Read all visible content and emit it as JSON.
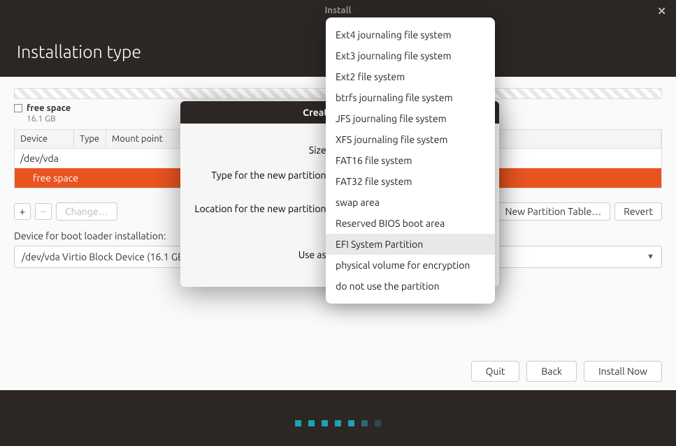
{
  "titlebar": {
    "title": "Install"
  },
  "page": {
    "title": "Installation type"
  },
  "disk": {
    "legend_name": "free space",
    "legend_size": "16.1 GB"
  },
  "table": {
    "headers": {
      "device": "Device",
      "type": "Type",
      "mount": "Mount point"
    },
    "rows": [
      {
        "device": "/dev/vda",
        "selected": false
      },
      {
        "device": "free space",
        "selected": true
      }
    ]
  },
  "toolbar": {
    "add": "+",
    "remove": "−",
    "change": "Change…",
    "new_table": "New Partition Table…",
    "revert": "Revert"
  },
  "bootloader": {
    "label": "Device for boot loader installation:",
    "value": "/dev/vda Virtio Block Device (16.1 GB)"
  },
  "footer": {
    "quit": "Quit",
    "back": "Back",
    "install": "Install Now"
  },
  "modal": {
    "title": "Create partition",
    "size_label": "Size:",
    "type_label": "Type for the new partition:",
    "location_label": "Location for the new partition:",
    "useas_label": "Use as:"
  },
  "fs_menu": {
    "items": [
      "Ext4 journaling file system",
      "Ext3 journaling file system",
      "Ext2 file system",
      "btrfs journaling file system",
      "JFS journaling file system",
      "XFS journaling file system",
      "FAT16 file system",
      "FAT32 file system",
      "swap area",
      "Reserved BIOS boot area",
      "EFI System Partition",
      "physical volume for encryption",
      "do not use the partition"
    ],
    "highlighted_index": 10
  }
}
